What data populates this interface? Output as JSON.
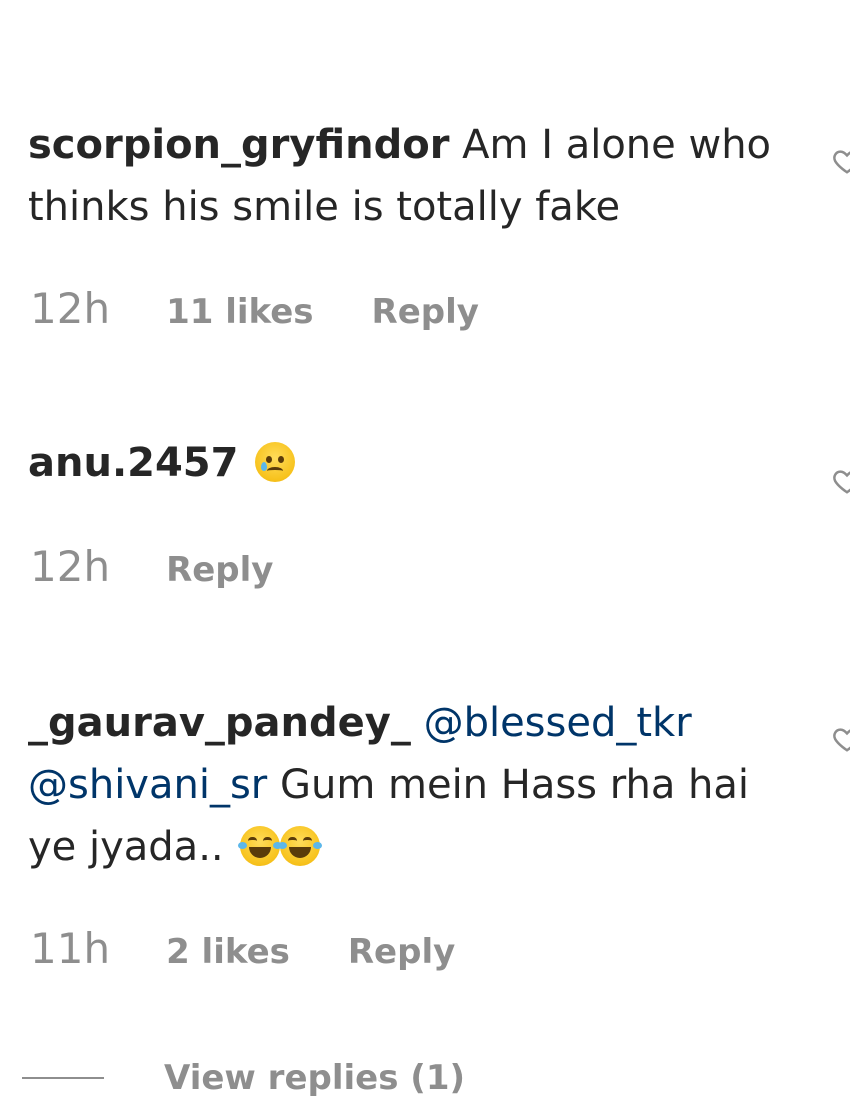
{
  "comments": [
    {
      "username": "scorpion_gryfindor",
      "text_parts": [
        "Am I alone who thinks his smile is totally fake"
      ],
      "time": "12h",
      "likes": "11 likes",
      "reply_label": "Reply"
    },
    {
      "username": "anu.2457",
      "emoji": "crying-face",
      "time": "12h",
      "reply_label": "Reply"
    },
    {
      "username": "_gaurav_pandey_",
      "mention_1": "@blessed_tkr",
      "mention_2": "@shivani_sr",
      "text": "Gum mein Hass rha hai ye jyada..",
      "emoji": "face-with-tears-of-joy",
      "time": "11h",
      "likes": "2 likes",
      "reply_label": "Reply"
    }
  ],
  "view_replies_label": "View replies (1)",
  "icons": {
    "like": "heart-outline-icon"
  },
  "colors": {
    "text": "#262626",
    "muted": "#8e8e8e",
    "mention": "#003569"
  }
}
